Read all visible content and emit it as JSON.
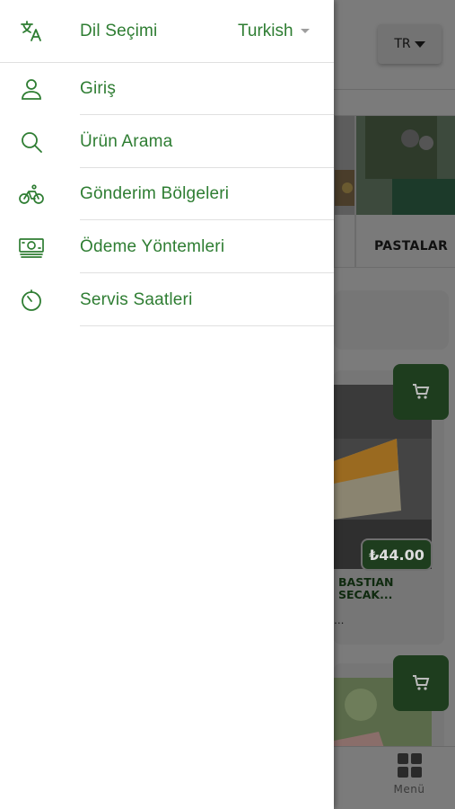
{
  "background": {
    "language_button": "TR",
    "category_label": "PASTALAR",
    "product": {
      "price": "₺44.00",
      "name_line1": "BASTIAN",
      "name_line2": "SECAK...",
      "desc": "..."
    },
    "bottom_nav": {
      "menu_label": "Menü"
    }
  },
  "drawer": {
    "language": {
      "label": "Dil Seçimi",
      "selected": "Turkish",
      "icon": "translate-icon"
    },
    "items": [
      {
        "label": "Giriş",
        "icon": "user-icon"
      },
      {
        "label": "Ürün Arama",
        "icon": "search-icon"
      },
      {
        "label": "Gönderim Bölgeleri",
        "icon": "bicycle-icon"
      },
      {
        "label": "Ödeme Yöntemleri",
        "icon": "cash-icon"
      },
      {
        "label": "Servis Saatleri",
        "icon": "timer-icon"
      }
    ]
  },
  "colors": {
    "accent": "#2e7d32",
    "overlay": "#7b7b7b",
    "drawer_bg": "#ffffff"
  }
}
